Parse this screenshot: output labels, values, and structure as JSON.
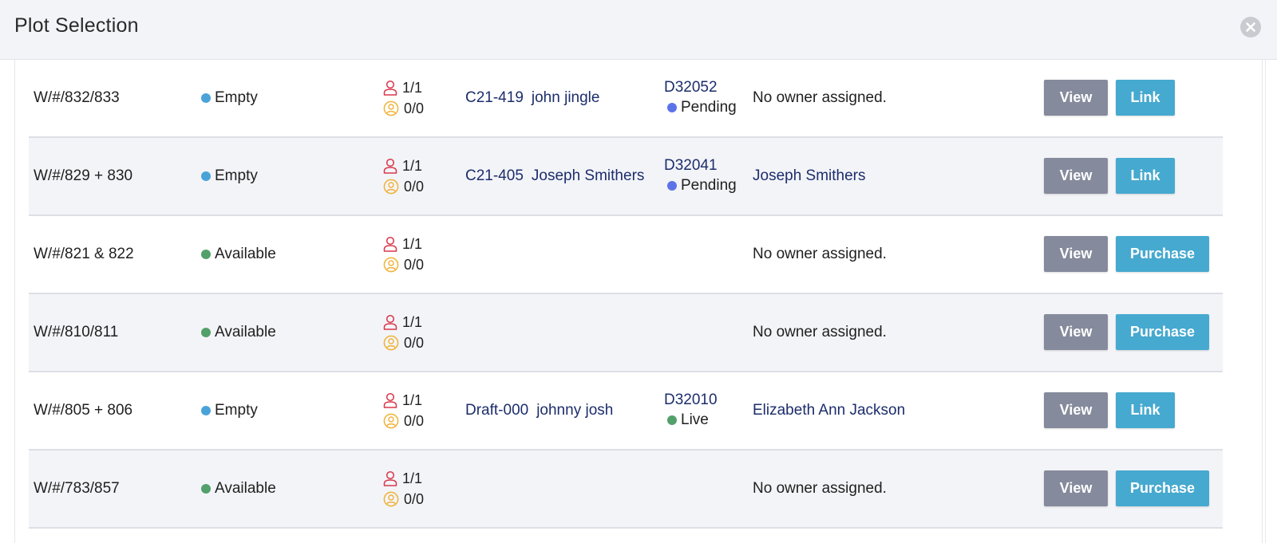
{
  "modal": {
    "title": "Plot Selection"
  },
  "colors": {
    "empty": "#4aa3d8",
    "available": "#52a06a",
    "pending": "#5b73e8",
    "live": "#52a06a"
  },
  "icons": {
    "close": "close-icon",
    "person": "person-outline-icon",
    "person_circle": "person-circle-icon"
  },
  "rows": [
    {
      "name": "W/#/832/833",
      "status": "Empty",
      "status_type": "empty",
      "occupancy": "1/1",
      "reservations": "0/0",
      "ref_code": "C21-419",
      "ref_name": "john jingle",
      "deed_code": "D32052",
      "deed_status": "Pending",
      "deed_status_type": "pending",
      "owner": "No owner assigned.",
      "owner_assigned": false,
      "view_label": "View",
      "action_label": "Link",
      "action_type": "link"
    },
    {
      "name": "W/#/829 + 830",
      "status": "Empty",
      "status_type": "empty",
      "occupancy": "1/1",
      "reservations": "0/0",
      "ref_code": "C21-405",
      "ref_name": "Joseph Smithers",
      "deed_code": "D32041",
      "deed_status": "Pending",
      "deed_status_type": "pending",
      "owner": "Joseph Smithers",
      "owner_assigned": true,
      "view_label": "View",
      "action_label": "Link",
      "action_type": "link"
    },
    {
      "name": "W/#/821 & 822",
      "status": "Available",
      "status_type": "available",
      "occupancy": "1/1",
      "reservations": "0/0",
      "ref_code": "",
      "ref_name": "",
      "deed_code": "",
      "deed_status": "",
      "deed_status_type": "",
      "owner": "No owner assigned.",
      "owner_assigned": false,
      "view_label": "View",
      "action_label": "Purchase",
      "action_type": "purchase"
    },
    {
      "name": "W/#/810/811",
      "status": "Available",
      "status_type": "available",
      "occupancy": "1/1",
      "reservations": "0/0",
      "ref_code": "",
      "ref_name": "",
      "deed_code": "",
      "deed_status": "",
      "deed_status_type": "",
      "owner": "No owner assigned.",
      "owner_assigned": false,
      "view_label": "View",
      "action_label": "Purchase",
      "action_type": "purchase"
    },
    {
      "name": "W/#/805 + 806",
      "status": "Empty",
      "status_type": "empty",
      "occupancy": "1/1",
      "reservations": "0/0",
      "ref_code": "Draft-000",
      "ref_name": "johnny josh",
      "deed_code": "D32010",
      "deed_status": "Live",
      "deed_status_type": "live",
      "owner": "Elizabeth Ann Jackson",
      "owner_assigned": true,
      "view_label": "View",
      "action_label": "Link",
      "action_type": "link"
    },
    {
      "name": "W/#/783/857",
      "status": "Available",
      "status_type": "available",
      "occupancy": "1/1",
      "reservations": "0/0",
      "ref_code": "",
      "ref_name": "",
      "deed_code": "",
      "deed_status": "",
      "deed_status_type": "",
      "owner": "No owner assigned.",
      "owner_assigned": false,
      "view_label": "View",
      "action_label": "Purchase",
      "action_type": "purchase"
    }
  ]
}
